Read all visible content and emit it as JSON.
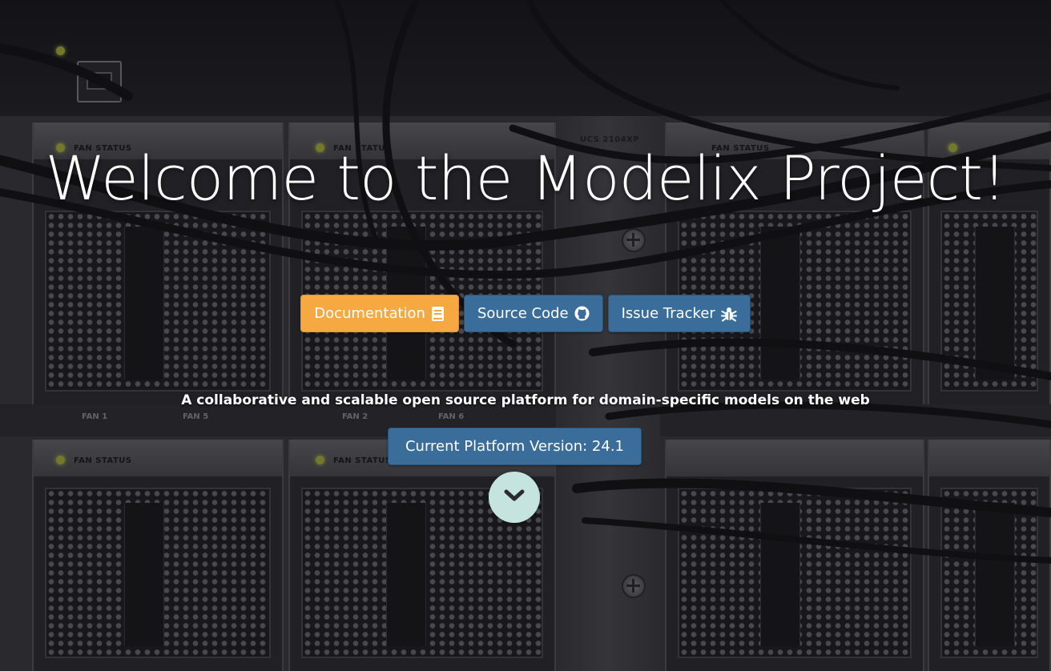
{
  "hero": {
    "title": "Welcome to the Modelix Project!",
    "tagline": "A collaborative and scalable open source platform for domain-specific models on the web"
  },
  "links": {
    "documentation_label": "Documentation",
    "documentation_icon": "book-icon",
    "source_code_label": "Source Code",
    "source_code_icon": "github-icon",
    "issue_tracker_label": "Issue Tracker",
    "issue_tracker_icon": "bug-icon"
  },
  "version": {
    "label": "Current Platform Version: 24.1"
  },
  "scroll": {
    "icon": "chevron-down-icon"
  },
  "background": {
    "fan_status": "FAN STATUS",
    "chassis_label": "UCS 2104XP",
    "fan_labels": [
      "FAN 1",
      "FAN 5",
      "FAN 2",
      "FAN 6"
    ]
  },
  "colors": {
    "documentation_button": "#f5a940",
    "primary_button": "#3a6d99",
    "scroll_button": "#c5e4e0",
    "text": "#ffffff"
  }
}
